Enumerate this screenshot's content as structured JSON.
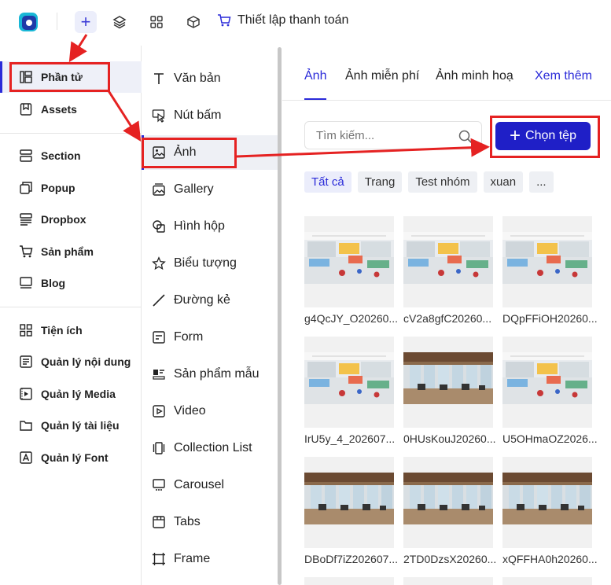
{
  "topbar": {
    "title": "Thiết lập thanh toán",
    "icons": [
      "logo-icon",
      "plus-icon",
      "layers-icon",
      "grid-icon",
      "box-icon",
      "cart-icon"
    ]
  },
  "sidebar": {
    "items": [
      {
        "label": "Phần tử",
        "icon": "elements-icon",
        "active": true
      },
      {
        "label": "Assets",
        "icon": "bookmark-icon"
      },
      {
        "label": "Section",
        "icon": "section-icon"
      },
      {
        "label": "Popup",
        "icon": "popup-icon"
      },
      {
        "label": "Dropbox",
        "icon": "dropbox-icon"
      },
      {
        "label": "Sản phẩm",
        "icon": "cart-icon"
      },
      {
        "label": "Blog",
        "icon": "blog-icon"
      },
      {
        "label": "Tiện ích",
        "icon": "apps-icon"
      },
      {
        "label": "Quản lý nội dung",
        "icon": "content-icon"
      },
      {
        "label": "Quản lý Media",
        "icon": "media-icon"
      },
      {
        "label": "Quản lý tài liệu",
        "icon": "folder-icon"
      },
      {
        "label": "Quản lý Font",
        "icon": "font-icon"
      }
    ]
  },
  "elements": {
    "items": [
      {
        "label": "Văn bản",
        "icon": "text-icon"
      },
      {
        "label": "Nút bấm",
        "icon": "cursor-icon"
      },
      {
        "label": "Ảnh",
        "icon": "image-icon",
        "active": true
      },
      {
        "label": "Gallery",
        "icon": "gallery-icon"
      },
      {
        "label": "Hình hộp",
        "icon": "shapes-icon"
      },
      {
        "label": "Biểu tượng",
        "icon": "star-icon"
      },
      {
        "label": "Đường kẻ",
        "icon": "line-icon"
      },
      {
        "label": "Form",
        "icon": "form-icon"
      },
      {
        "label": "Sản phẩm mẫu",
        "icon": "product-sample-icon"
      },
      {
        "label": "Video",
        "icon": "video-icon"
      },
      {
        "label": "Collection List",
        "icon": "collection-icon"
      },
      {
        "label": "Carousel",
        "icon": "carousel-icon"
      },
      {
        "label": "Tabs",
        "icon": "tabs-icon"
      },
      {
        "label": "Frame",
        "icon": "frame-icon"
      }
    ]
  },
  "panel": {
    "tabs": [
      {
        "label": "Ảnh",
        "active": true
      },
      {
        "label": "Ảnh miễn phí"
      },
      {
        "label": "Ảnh minh hoạ"
      }
    ],
    "more_label": "Xem thêm",
    "search_placeholder": "Tìm kiếm...",
    "choose_button": "Chọn tệp",
    "filters": [
      {
        "label": "Tất cả",
        "active": true
      },
      {
        "label": "Trang"
      },
      {
        "label": "Test nhóm"
      },
      {
        "label": "xuan"
      },
      {
        "label": "..."
      }
    ],
    "images": [
      {
        "name": "g4QcJY_O20260...",
        "scene": "classroom"
      },
      {
        "name": "cV2a8gfC20260...",
        "scene": "classroom"
      },
      {
        "name": "DQpFFiOH20260...",
        "scene": "classroom"
      },
      {
        "name": "IrU5y_4_202607...",
        "scene": "classroom"
      },
      {
        "name": "0HUsKouJ20260...",
        "scene": "gym"
      },
      {
        "name": "U5OHmaOZ2026...",
        "scene": "classroom"
      },
      {
        "name": "DBoDf7iZ202607...",
        "scene": "gym"
      },
      {
        "name": "2TD0DzsX20260...",
        "scene": "gym"
      },
      {
        "name": "xQFFHA0h20260...",
        "scene": "gym"
      }
    ]
  },
  "colors": {
    "accent": "#2b2bd9",
    "button": "#1f1fc7",
    "annotation": "#e52222"
  }
}
